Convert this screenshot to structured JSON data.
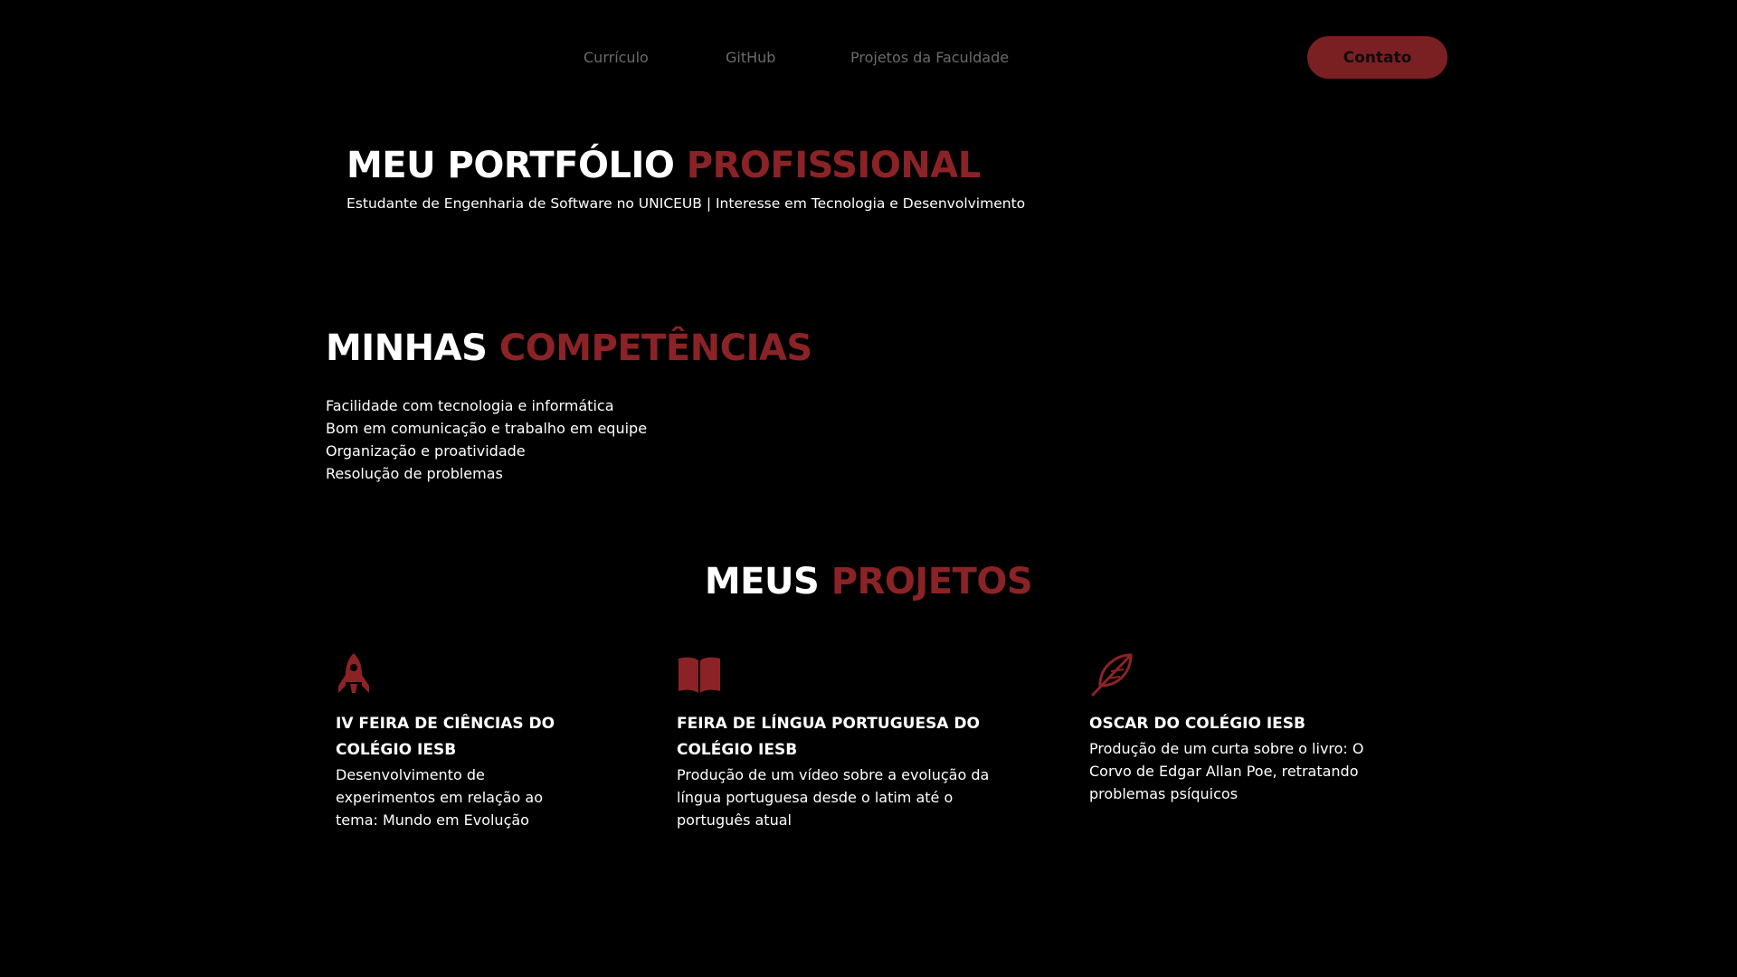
{
  "nav": {
    "links": [
      "Currículo",
      "GitHub",
      "Projetos da Faculdade"
    ],
    "contact_label": "Contato"
  },
  "hero": {
    "title_main": "MEU PORTFÓLIO ",
    "title_accent": "PROFISSIONAL",
    "subtitle": "Estudante de Engenharia de Software no UNICEUB | Interesse em Tecnologia e Desenvolvimento"
  },
  "skills": {
    "title_main": "MINHAS ",
    "title_accent": "COMPETÊNCIAS",
    "items": [
      "Facilidade com tecnologia e informática",
      "Bom em comunicação e trabalho em equipe",
      "Organização e proatividade",
      "Resolução de problemas"
    ]
  },
  "projects": {
    "title_main": "MEUS ",
    "title_accent": "PROJETOS",
    "items": [
      {
        "icon": "rocket-icon",
        "title": "IV FEIRA DE CIÊNCIAS DO COLÉGIO IESB",
        "description": "Desenvolvimento de experimentos em relação ao tema: Mundo em Evolução"
      },
      {
        "icon": "book-icon",
        "title": "FEIRA DE LÍNGUA PORTUGUESA DO COLÉGIO IESB",
        "description": "Produção de um vídeo sobre a evolução da língua portuguesa desde o latim até o português atual"
      },
      {
        "icon": "feather-icon",
        "title": "OSCAR DO COLÉGIO IESB",
        "description": "Produção de um curta sobre o livro: O Corvo de Edgar Allan Poe, retratando problemas psíquicos"
      }
    ]
  },
  "colors": {
    "background": "#000000",
    "accent": "#8b2326",
    "button": "#7a1f22",
    "nav_text": "#6b6b6b"
  }
}
